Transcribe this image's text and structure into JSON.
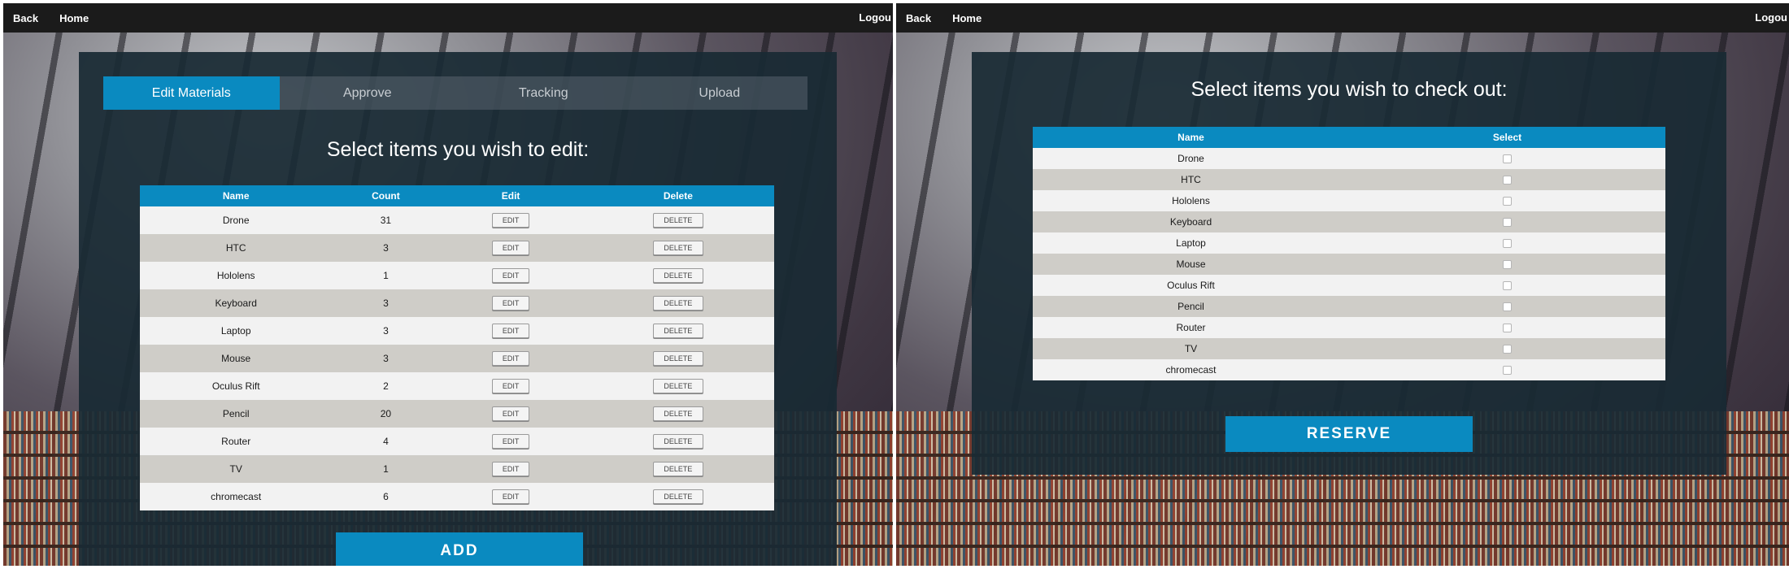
{
  "left": {
    "nav": {
      "back": "Back",
      "home": "Home",
      "logout": "Logou"
    },
    "tabs": [
      "Edit Materials",
      "Approve",
      "Tracking",
      "Upload"
    ],
    "heading": "Select items you wish to edit:",
    "table": {
      "headers": [
        "Name",
        "Count",
        "Edit",
        "Delete"
      ],
      "rows": [
        {
          "name": "Drone",
          "count": "31"
        },
        {
          "name": "HTC",
          "count": "3"
        },
        {
          "name": "Hololens",
          "count": "1"
        },
        {
          "name": "Keyboard",
          "count": "3"
        },
        {
          "name": "Laptop",
          "count": "3"
        },
        {
          "name": "Mouse",
          "count": "3"
        },
        {
          "name": "Oculus Rift",
          "count": "2"
        },
        {
          "name": "Pencil",
          "count": "20"
        },
        {
          "name": "Router",
          "count": "4"
        },
        {
          "name": "TV",
          "count": "1"
        },
        {
          "name": "chromecast",
          "count": "6"
        }
      ],
      "edit_label": "EDIT",
      "delete_label": "DELETE"
    },
    "add_label": "ADD"
  },
  "right": {
    "nav": {
      "back": "Back",
      "home": "Home",
      "logout": "Logou"
    },
    "heading": "Select items you wish to check out:",
    "table": {
      "headers": [
        "Name",
        "Select"
      ],
      "rows": [
        "Drone",
        "HTC",
        "Hololens",
        "Keyboard",
        "Laptop",
        "Mouse",
        "Oculus Rift",
        "Pencil",
        "Router",
        "TV",
        "chromecast"
      ]
    },
    "reserve_label": "RESERVE"
  },
  "colors": {
    "accent": "#0a8ac0",
    "panel": "#192a34",
    "topbar": "#1b1b1b",
    "row_light": "#f2f2f2",
    "row_dark": "#cfcdc8"
  }
}
